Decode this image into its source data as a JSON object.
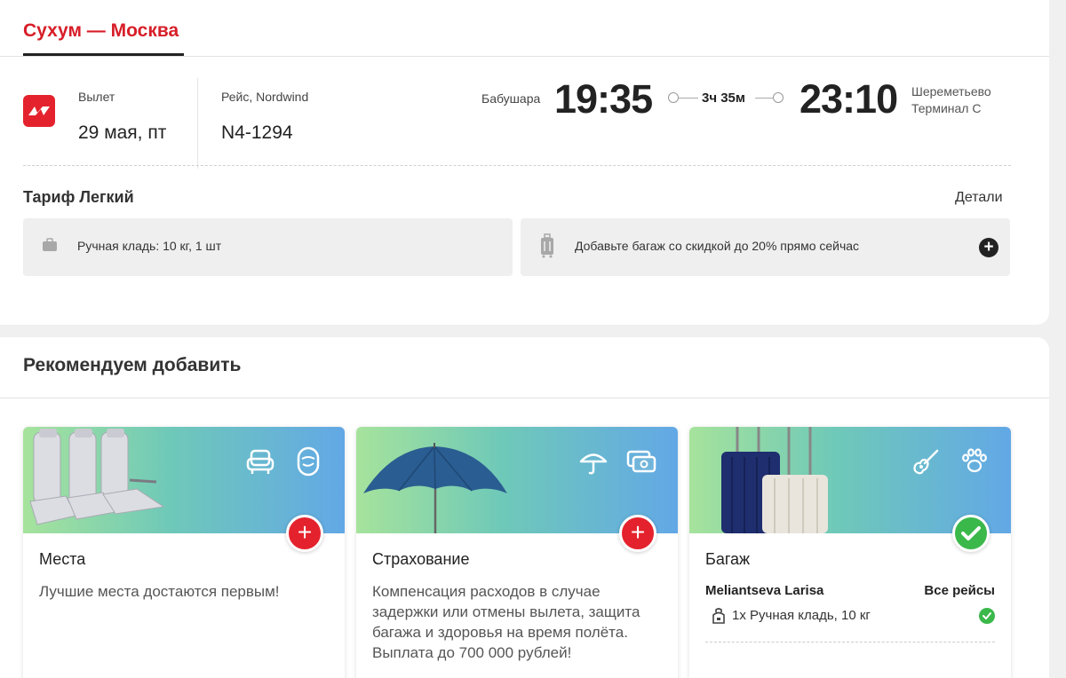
{
  "route": {
    "title": "Сухум — Москва"
  },
  "flight": {
    "departure_label": "Вылет",
    "departure_date": "29 мая, пт",
    "flight_label": "Рейс, Nordwind",
    "flight_number": "N4-1294",
    "from_airport": "Бабушара",
    "departure_time": "19:35",
    "duration": "3ч 35м",
    "arrival_time": "23:10",
    "to_airport": "Шереметьево",
    "to_terminal": "Терминал C"
  },
  "tariff": {
    "title": "Тариф Легкий",
    "details": "Детали",
    "hand_luggage": "Ручная кладь: 10 кг, 1 шт",
    "add_baggage": "Добавьте багаж со скидкой до 20% прямо сейчас"
  },
  "recommend": {
    "title": "Рекомендуем добавить",
    "cards": [
      {
        "title": "Места",
        "desc": "Лучшие места достаются первым!",
        "icons": [
          "seat-icon",
          "window-icon"
        ]
      },
      {
        "title": "Страхование",
        "desc": "Компенсация расходов в случае задержки или отмены вылета, защита багажа и здоровья на время полёта. Выплата до 700 000 рублей!",
        "icons": [
          "umbrella-icon",
          "money-icon"
        ]
      },
      {
        "title": "Багаж",
        "passenger": "Meliantseva Larisa",
        "scope": "Все рейсы",
        "item": "1x Ручная кладь, 10 кг",
        "icons": [
          "guitar-icon",
          "paw-icon"
        ]
      }
    ]
  },
  "colors": {
    "accent": "#d71e28",
    "success": "#3bb84a",
    "dark": "#222222"
  }
}
